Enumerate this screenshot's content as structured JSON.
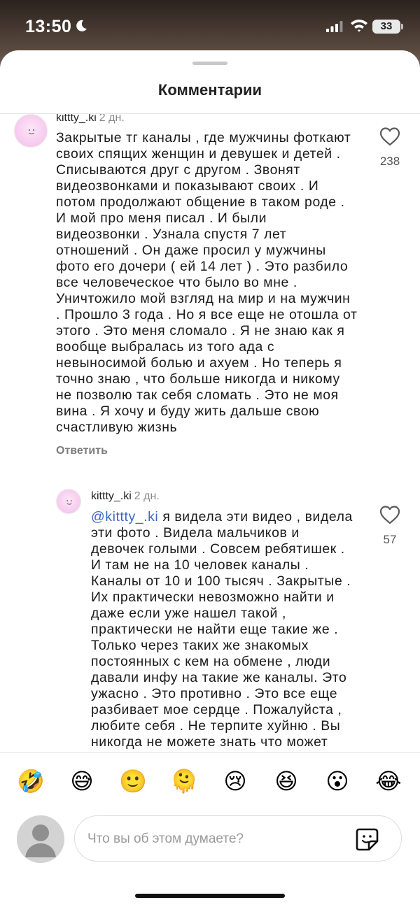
{
  "status_bar": {
    "time": "13:50",
    "battery": "33"
  },
  "sheet": {
    "title": "Комментарии"
  },
  "comments": [
    {
      "author": "kittty_.ki",
      "age": "2 дн.",
      "text": "Закрытые тг каналы , где мужчины фоткают\nсвоих спящих женщин и девушек  и детей .\nСписываются друг с другом . Звонят\nвидеозвонками и показывают своих . И\nпотом продолжают общение в таком роде .\nИ мой про меня писал . И были\nвидеозвонки . Узнала спустя 7 лет\nотношений . Он даже просил у мужчины\nфото его дочери ( ей 14 лет ) . Это разбило\nвсе человеческое что было во мне .\nУничтожило мой взгляд на мир и на мужчин\n. Прошло 3 года . Но я все еще не отошла от\nэтого . Это меня сломало . Я не знаю как я\nвообще выбралась из того ада с\nневыносимой болью и ахуем . Но теперь я\nточно знаю , что больше никогда и никому\nне позволю так себя сломать . Это не моя\nвина . Я хочу и буду жить дальше свою\nсчастливую жизнь",
      "likes": "238",
      "reply_label": "Ответить"
    },
    {
      "author": "kittty_.ki",
      "age": "2 дн.",
      "mention": "@kittty_.ki",
      "text": " я видела эти видео , видела\nэти фото . Видела мальчиков и\nдевочек голыми . Совсем ребятишек .\nИ там не на 10 человек каналы .\nКаналы от 10 и 100 тысяч . Закрытые .\nИх практически невозможно найти и\nдаже если уже нашел такой ,\nпрактически не найти еще такие же .\nТолько через таких же знакомых\nпостоянных с кем на обмене , люди\nдавали инфу на такие же каналы. Это\nужасно . Это противно . Это все еще\nразбивает мое сердце . Пожалуйста ,\nлюбите себя . Не терпите хуйню . Вы\nникогда не можете знать что может",
      "likes": "57"
    }
  ],
  "emoji_bar": [
    "🤣",
    "😅",
    "🙂",
    "🫠",
    "😢",
    "😆",
    "😮",
    "😂"
  ],
  "composer": {
    "placeholder": "Что вы об этом думаете?"
  },
  "icons": {
    "moon": "moon-icon",
    "signal": "cellular-signal-icon",
    "wifi": "wifi-icon",
    "like": "heart-outline-icon",
    "sticker": "sticker-icon",
    "avatar": "default-avatar-icon"
  },
  "colors": {
    "mention": "#3c68c7",
    "muted_text": "#8a8a8a",
    "avatar_pink": "#f6c9ee"
  }
}
